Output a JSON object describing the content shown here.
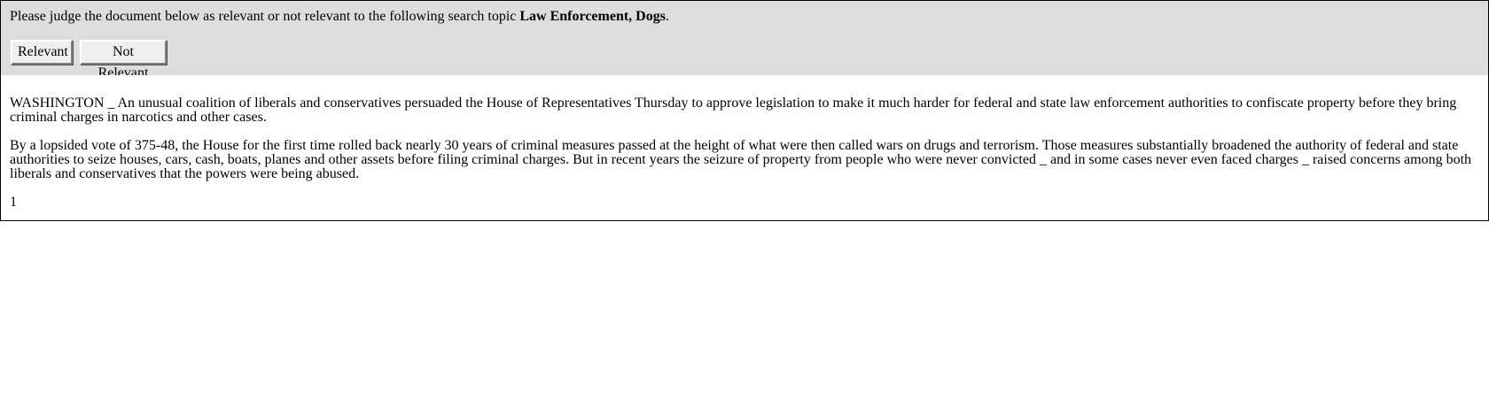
{
  "prompt": {
    "prefix": "Please judge the document below as relevant or not relevant to the following search topic ",
    "topic": "Law Enforcement, Dogs",
    "suffix": "."
  },
  "buttons": {
    "relevant": "Relevant",
    "not_relevant": "Not Relevant"
  },
  "document": {
    "paragraphs": [
      "WASHINGTON _ An unusual coalition of liberals and conservatives persuaded the House of Representatives Thursday to approve legislation to make it much harder for federal and state law enforcement authorities to confiscate property before they bring criminal charges in narcotics and other cases.",
      "By a lopsided vote of 375-48, the House for the first time rolled back nearly 30 years of criminal measures passed at the height of what were then called wars on drugs and terrorism. Those measures substantially broadened the authority of federal and state authorities to seize houses, cars, cash, boats, planes and other assets before filing criminal charges. But in recent years the seizure of property from people who were never convicted _ and in some cases never even faced charges _ raised concerns among both liberals and conservatives that the powers were being abused."
    ],
    "page_number": "1"
  },
  "colors": {
    "panel_background": "#dddddd",
    "cursor": "#ff0000"
  }
}
